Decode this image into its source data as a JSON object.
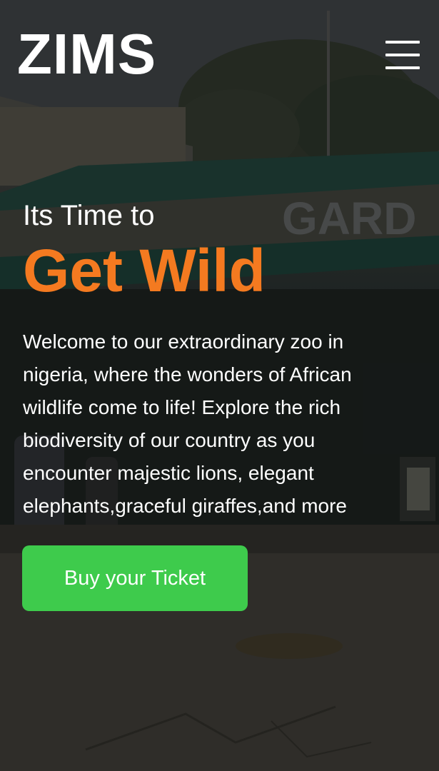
{
  "header": {
    "logo_text": "ZIMS",
    "menu_icon": "hamburger-menu-icon"
  },
  "hero": {
    "tagline": "Its Time to",
    "headline": "Get Wild",
    "intro": "Welcome to our extraordinary zoo in nigeria, where the wonders of African wildlife come to life! Explore the rich biodiversity of our country as you encounter majestic lions, elegant elephants,graceful giraffes,and more",
    "background_sign_text": "GARD",
    "cta_label": "Buy your Ticket"
  },
  "colors": {
    "accent_orange": "#f47a20",
    "cta_green": "#3ecb4c",
    "text_white": "#ffffff"
  }
}
